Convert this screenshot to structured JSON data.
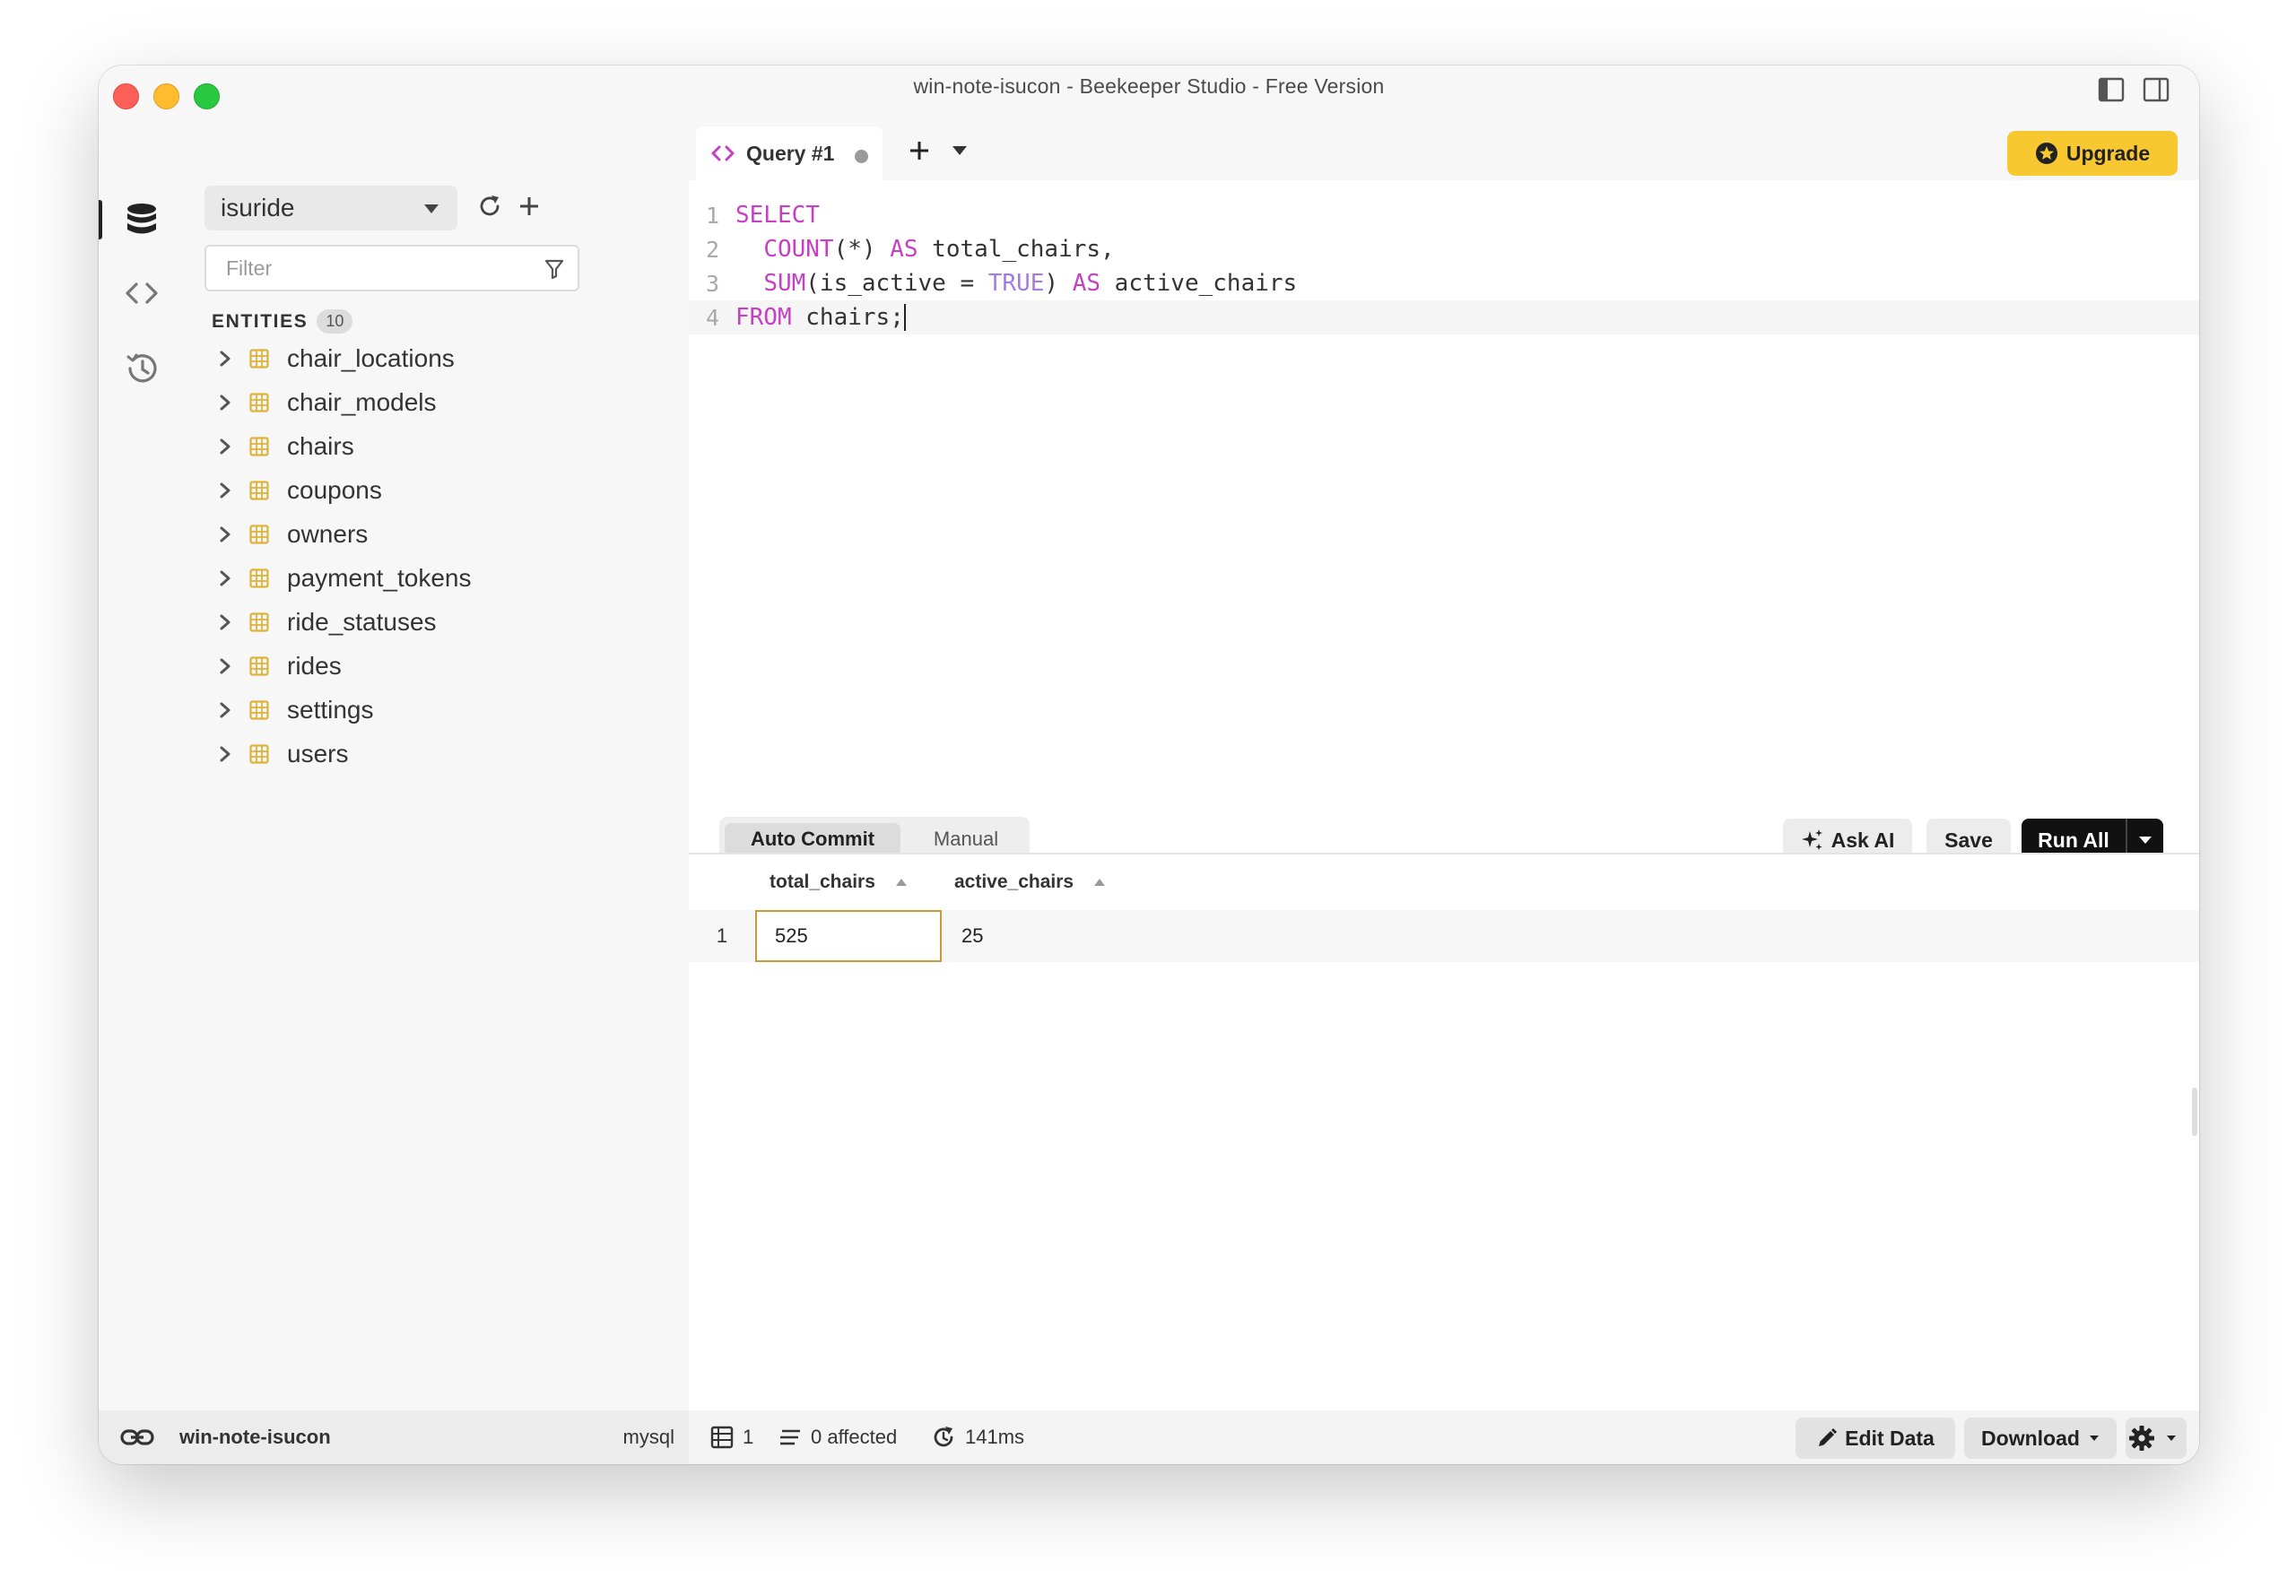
{
  "window": {
    "title": "win-note-isucon - Beekeeper Studio - Free Version"
  },
  "sidebar": {
    "connection": "isuride",
    "filter_placeholder": "Filter",
    "entities_label": "ENTITIES",
    "entities_count": "10",
    "entities": [
      "chair_locations",
      "chair_models",
      "chairs",
      "coupons",
      "owners",
      "payment_tokens",
      "ride_statuses",
      "rides",
      "settings",
      "users"
    ]
  },
  "tabs": {
    "active_label": "Query #1"
  },
  "header": {
    "upgrade_label": "Upgrade"
  },
  "editor": {
    "line_numbers": [
      "1",
      "2",
      "3",
      "4"
    ],
    "lines": [
      [
        {
          "t": "SELECT",
          "c": "kw"
        }
      ],
      [
        {
          "t": "  ",
          "c": "id"
        },
        {
          "t": "COUNT",
          "c": "kw"
        },
        {
          "t": "(*) ",
          "c": "id"
        },
        {
          "t": "AS",
          "c": "kw"
        },
        {
          "t": " total_chairs,",
          "c": "id"
        }
      ],
      [
        {
          "t": "  ",
          "c": "id"
        },
        {
          "t": "SUM",
          "c": "kw"
        },
        {
          "t": "(is_active = ",
          "c": "id"
        },
        {
          "t": "TRUE",
          "c": "lit"
        },
        {
          "t": ") ",
          "c": "id"
        },
        {
          "t": "AS",
          "c": "kw"
        },
        {
          "t": " active_chairs",
          "c": "id"
        }
      ],
      [
        {
          "t": "FROM",
          "c": "kw"
        },
        {
          "t": " chairs;",
          "c": "id"
        }
      ]
    ]
  },
  "query_toolbar": {
    "auto_commit": "Auto Commit",
    "manual": "Manual",
    "ask_ai": "Ask AI",
    "save": "Save",
    "run_all": "Run All"
  },
  "results": {
    "columns": [
      "total_chairs",
      "active_chairs"
    ],
    "rows": [
      {
        "num": "1",
        "values": [
          "525",
          "25"
        ]
      }
    ]
  },
  "statusbar": {
    "connection_name": "win-note-isucon",
    "db_type": "mysql",
    "row_count": "1",
    "affected": "0 affected",
    "duration": "141ms",
    "edit_data": "Edit Data",
    "download": "Download"
  },
  "colors": {
    "keyword": "#c73fc4",
    "literal": "#a47be0",
    "upgrade_bg": "#f7c830",
    "table_icon": "#e0b23a",
    "selected_cell_border": "#c79b3c",
    "run_bg": "#111111"
  }
}
